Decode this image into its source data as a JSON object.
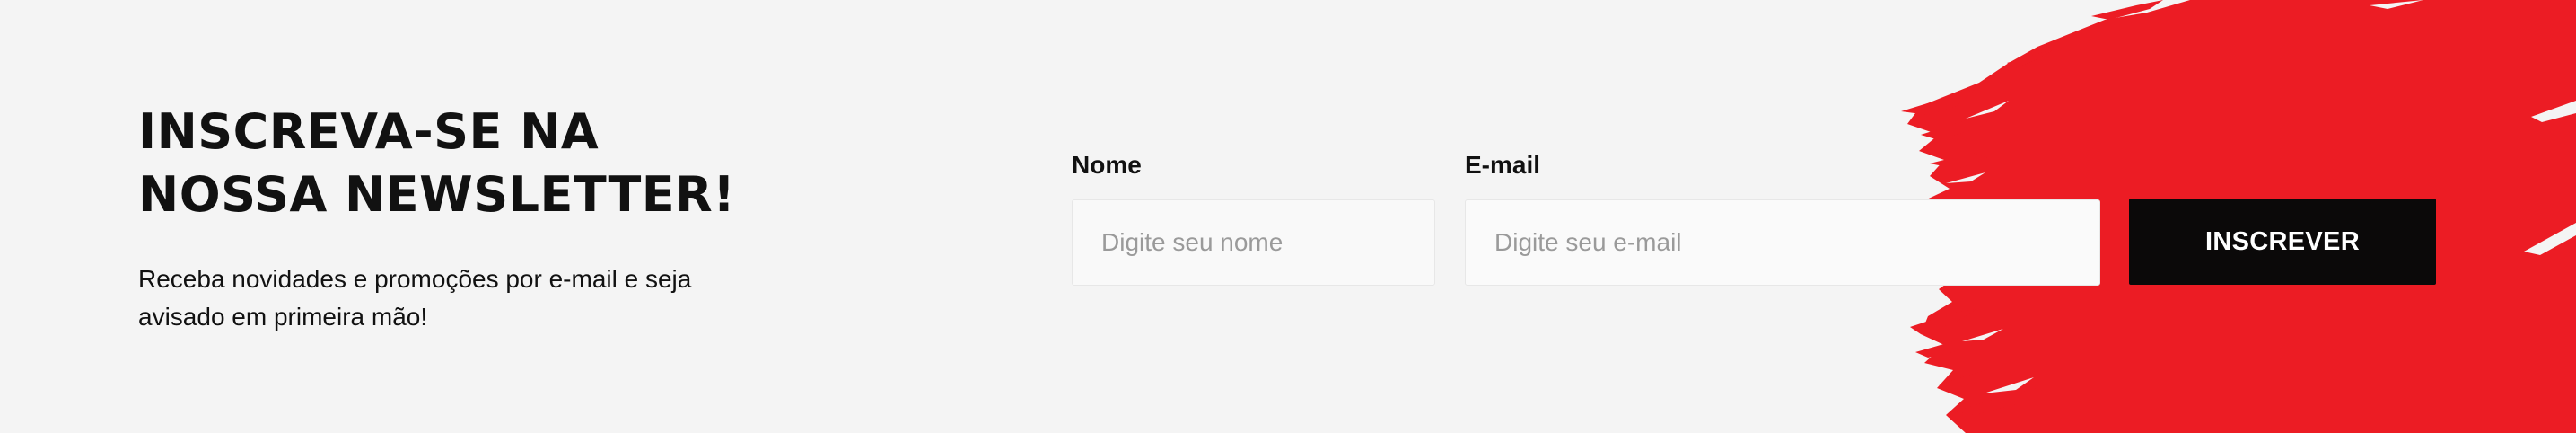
{
  "newsletter": {
    "title": "INSCREVA-SE NA NOSSA NEWSLETTER!",
    "description": "Receba novidades e promoções por e-mail e seja avisado em primeira mão!"
  },
  "form": {
    "name_label": "Nome",
    "name_placeholder": "Digite seu nome",
    "email_label": "E-mail",
    "email_placeholder": "Digite seu e-mail",
    "submit_label": "INSCREVER"
  },
  "colors": {
    "background": "#f4f4f4",
    "brush_accent": "#ec1c24",
    "button": "#0b0909",
    "text": "#111111"
  }
}
